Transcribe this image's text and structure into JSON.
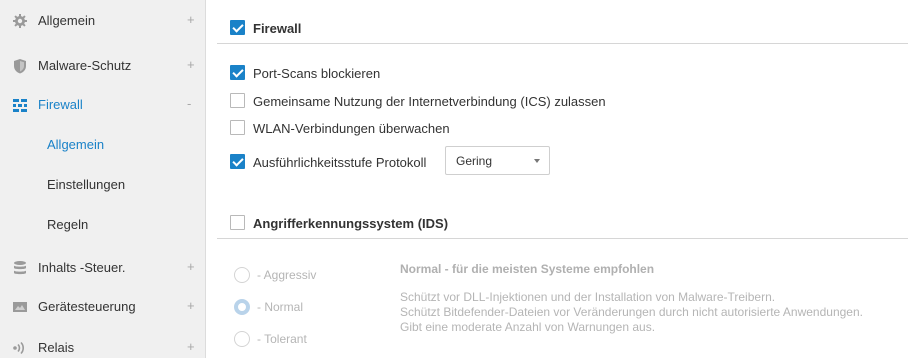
{
  "sidebar": {
    "items": [
      {
        "label": "Allgemein",
        "toggle": "+",
        "icon": "gear-icon"
      },
      {
        "label": "Malware-Schutz",
        "toggle": "+",
        "icon": "shield-icon"
      },
      {
        "label": "Firewall",
        "toggle": "-",
        "icon": "firewall-icon"
      },
      {
        "label": "Inhalts -Steuer.",
        "toggle": "+",
        "icon": "database-icon"
      },
      {
        "label": "Gerätesteuerung",
        "toggle": "+",
        "icon": "device-icon"
      },
      {
        "label": "Relais",
        "toggle": "+",
        "icon": "relay-icon"
      }
    ],
    "sub_items": [
      {
        "label": "Allgemein"
      },
      {
        "label": "Einstellungen"
      },
      {
        "label": "Regeln"
      }
    ]
  },
  "firewall": {
    "header": "Firewall",
    "options": [
      {
        "label": "Port-Scans blockieren",
        "checked": true
      },
      {
        "label": "Gemeinsame Nutzung der Internetverbindung (ICS) zulassen",
        "checked": false
      },
      {
        "label": "WLAN-Verbindungen überwachen",
        "checked": false
      },
      {
        "label": "Ausführlichkeitsstufe Protokoll",
        "checked": true
      }
    ],
    "log_level": {
      "value": "Gering"
    }
  },
  "ids": {
    "header": "Angrifferkennungssystem (IDS)",
    "levels": [
      {
        "label": "- Aggressiv"
      },
      {
        "label": "- Normal"
      },
      {
        "label": "- Tolerant"
      }
    ],
    "description": {
      "title": "Normal - für die meisten Systeme empfohlen",
      "lines": [
        "Schützt vor DLL-Injektionen und der Installation von Malware-Treibern.",
        "Schützt Bitdefender-Dateien vor Veränderungen durch nicht autorisierte Anwendungen.",
        "Gibt eine moderate Anzahl von Warnungen aus."
      ]
    }
  },
  "colors": {
    "accent": "#1a82c8",
    "sidebar_bg": "#f0f0f0",
    "disabled_text": "#b5b5b5"
  }
}
